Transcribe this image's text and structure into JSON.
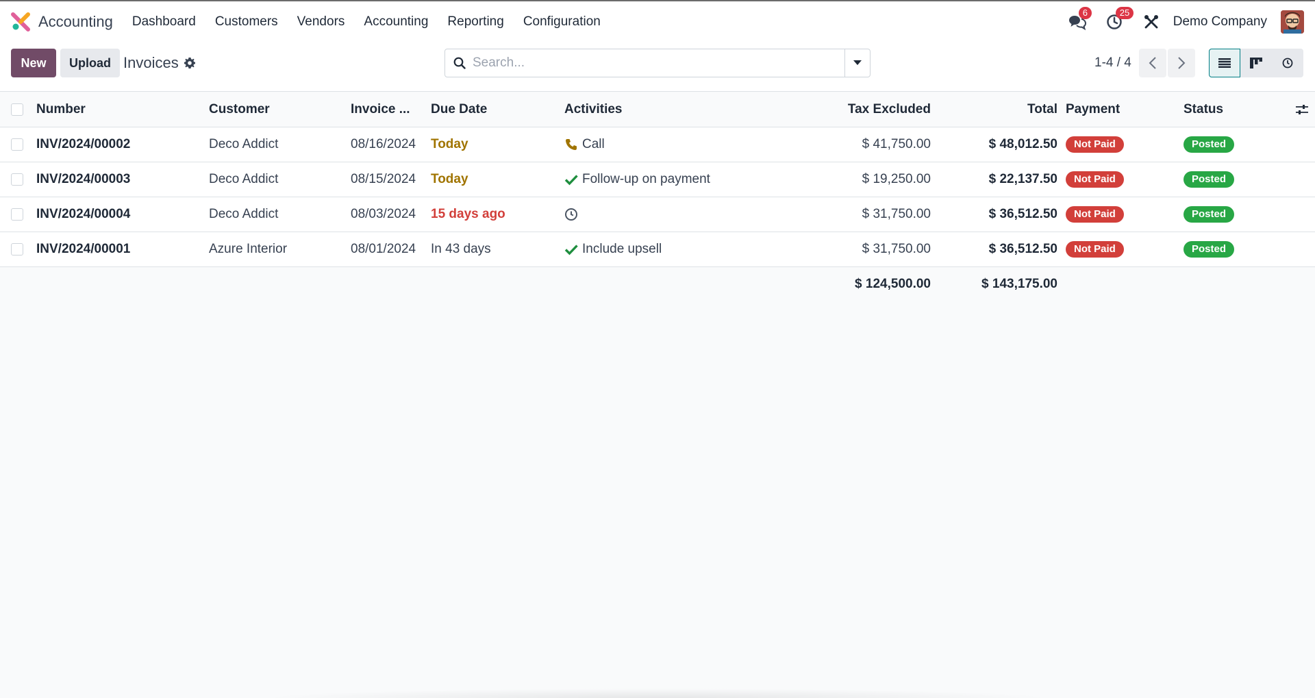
{
  "app": {
    "name": "Accounting",
    "menu": [
      "Dashboard",
      "Customers",
      "Vendors",
      "Accounting",
      "Reporting",
      "Configuration"
    ],
    "messages_count": "6",
    "activities_count": "25",
    "company": "Demo Company"
  },
  "control_panel": {
    "new_label": "New",
    "upload_label": "Upload",
    "title": "Invoices",
    "search_placeholder": "Search...",
    "pager": "1-4 / 4"
  },
  "table": {
    "columns": {
      "number": "Number",
      "customer": "Customer",
      "invoice_date": "Invoice ...",
      "due_date": "Due Date",
      "activities": "Activities",
      "tax_excluded": "Tax Excluded",
      "total": "Total",
      "payment": "Payment",
      "status": "Status"
    },
    "rows": [
      {
        "number": "INV/2024/00002",
        "customer": "Deco Addict",
        "invoice_date": "08/16/2024",
        "due_date": "Today",
        "due_state": "today",
        "activity_icon": "phone-icon",
        "activity": "Call",
        "tax_excluded": "$ 41,750.00",
        "total": "$ 48,012.50",
        "payment": "Not Paid",
        "status": "Posted"
      },
      {
        "number": "INV/2024/00003",
        "customer": "Deco Addict",
        "invoice_date": "08/15/2024",
        "due_date": "Today",
        "due_state": "today",
        "activity_icon": "check-icon",
        "activity": "Follow-up on payment",
        "tax_excluded": "$ 19,250.00",
        "total": "$ 22,137.50",
        "payment": "Not Paid",
        "status": "Posted"
      },
      {
        "number": "INV/2024/00004",
        "customer": "Deco Addict",
        "invoice_date": "08/03/2024",
        "due_date": "15 days ago",
        "due_state": "late",
        "activity_icon": "clock-icon",
        "activity": "",
        "tax_excluded": "$ 31,750.00",
        "total": "$ 36,512.50",
        "payment": "Not Paid",
        "status": "Posted"
      },
      {
        "number": "INV/2024/00001",
        "customer": "Azure Interior",
        "invoice_date": "08/01/2024",
        "due_date": "In 43 days",
        "due_state": "future",
        "activity_icon": "check-icon",
        "activity": "Include upsell",
        "tax_excluded": "$ 31,750.00",
        "total": "$ 36,512.50",
        "payment": "Not Paid",
        "status": "Posted"
      }
    ],
    "totals": {
      "tax_excluded": "$ 124,500.00",
      "total": "$ 143,175.00"
    }
  }
}
